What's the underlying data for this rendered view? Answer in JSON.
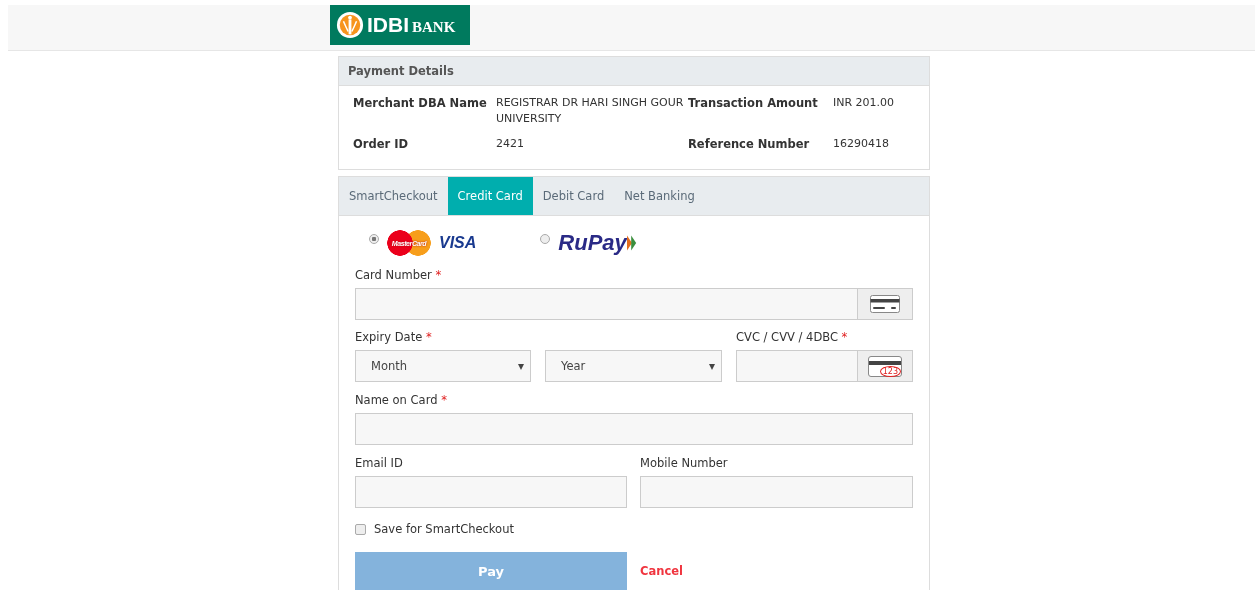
{
  "header": {
    "logo": {
      "short": "IDBI",
      "name": "BANK"
    }
  },
  "payment_details": {
    "title": "Payment Details",
    "rows": [
      {
        "label": "Merchant DBA Name",
        "value": "REGISTRAR DR HARI SINGH GOUR UNIVERSITY",
        "label_2": "Transaction Amount",
        "value_2": "INR 201.00"
      },
      {
        "label": "Order ID",
        "value": "2421",
        "label_2": "Reference Number",
        "value_2": "16290418"
      }
    ]
  },
  "tabs": [
    {
      "label": "SmartCheckout",
      "selected": false
    },
    {
      "label": "Credit Card",
      "selected": true
    },
    {
      "label": "Debit Card",
      "selected": false
    },
    {
      "label": "Net Banking",
      "selected": false
    }
  ],
  "card_types": [
    {
      "kind": "mastercard-visa",
      "logo_1": "MasterCard",
      "logo_2": "VISA",
      "selected": true
    },
    {
      "kind": "rupay",
      "logo_1": "RuPay",
      "selected": false
    }
  ],
  "card_number": {
    "label": "Card Number",
    "marker": "*"
  },
  "expiry": {
    "label": "Expiry Date",
    "marker": "*",
    "month": "Month",
    "year": "Year"
  },
  "cvc": {
    "label": "CVC / CVV / 4DBC",
    "marker": "*",
    "icon_text": "123"
  },
  "name_on_card": {
    "label": "Name on Card",
    "marker": "*"
  },
  "email": {
    "label": "Email ID"
  },
  "mobile": {
    "label": "Mobile Number"
  },
  "save": {
    "label": "Save for SmartCheckout",
    "checked": false
  },
  "actions": {
    "pay": "Pay",
    "cancel": "Cancel"
  }
}
